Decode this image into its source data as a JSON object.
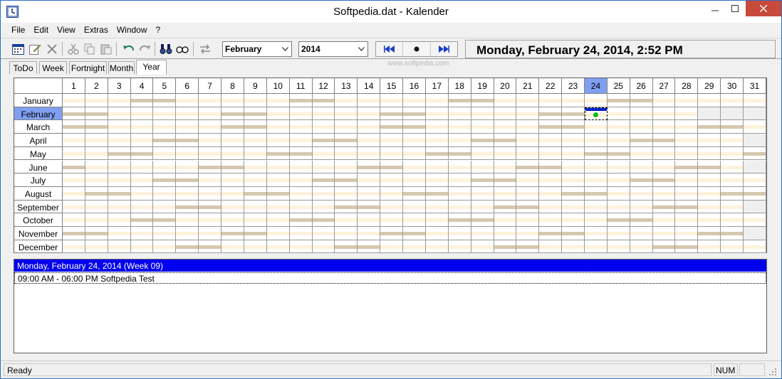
{
  "window": {
    "title": "Softpedia.dat - Kalender"
  },
  "menu": [
    "File",
    "Edit",
    "View",
    "Extras",
    "Window",
    "?"
  ],
  "toolbar": {
    "month_select": "February",
    "year_select": "2014",
    "current_datetime": "Monday, February 24, 2014, 2:52 PM",
    "icons": [
      "calendar-icon",
      "edit-icon",
      "delete-icon",
      "cut-icon",
      "copy-icon",
      "paste-icon",
      "undo-icon",
      "redo-icon",
      "find-icon",
      "find-next-icon",
      "swap-icon"
    ]
  },
  "tabs": [
    {
      "label": "ToDo",
      "active": false
    },
    {
      "label": "Week",
      "active": false
    },
    {
      "label": "Fortnight",
      "active": false
    },
    {
      "label": "Month",
      "active": false
    },
    {
      "label": "Year",
      "active": true
    }
  ],
  "watermark": "www.softpedia.com",
  "year_view": {
    "year": 2014,
    "selected_month": "February",
    "selected_day": 24,
    "months": [
      "January",
      "February",
      "March",
      "April",
      "May",
      "June",
      "July",
      "August",
      "September",
      "October",
      "November",
      "December"
    ],
    "days": [
      "1",
      "2",
      "3",
      "4",
      "5",
      "6",
      "7",
      "8",
      "9",
      "10",
      "11",
      "12",
      "13",
      "14",
      "15",
      "16",
      "17",
      "18",
      "19",
      "20",
      "21",
      "22",
      "23",
      "24",
      "25",
      "26",
      "27",
      "28",
      "29",
      "30",
      "31"
    ]
  },
  "detail": {
    "header": "Monday, February 24, 2014 (Week 09)",
    "entries": [
      "09:00 AM - 06:00 PM Softpedia Test"
    ]
  },
  "status": {
    "text": "Ready",
    "num": "NUM"
  },
  "colors": {
    "selection": "#0000ee",
    "today_header": "#7f9ff0",
    "weekend_bar": "#d6c8ae",
    "weekday_bar": "#fdf3dc",
    "event_dot": "#14b814"
  }
}
